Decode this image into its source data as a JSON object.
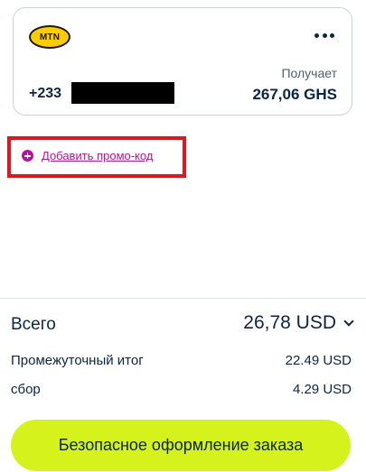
{
  "recipient": {
    "operator_logo": "MTN",
    "more_icon": "more-horizontal-icon",
    "receives_label": "Получает",
    "phone_prefix": "+233",
    "receive_amount": "267,06 GHS"
  },
  "promo": {
    "icon": "plus-circle-icon",
    "link_label": "Добавить промо-код"
  },
  "summary": {
    "total_label": "Всего",
    "total_value": "26,78 USD",
    "subtotal_label": "Промежуточный итог",
    "subtotal_value": "22.49 USD",
    "fee_label": "сбор",
    "fee_value": "4.29 USD"
  },
  "checkout": {
    "button_label": "Безопасное оформление заказа"
  },
  "colors": {
    "accent_button": "#d6f21d",
    "promo_link": "#b7129c",
    "highlight_border": "#e0161d",
    "text_primary": "#0b2545",
    "operator_yellow": "#ffcc00"
  }
}
